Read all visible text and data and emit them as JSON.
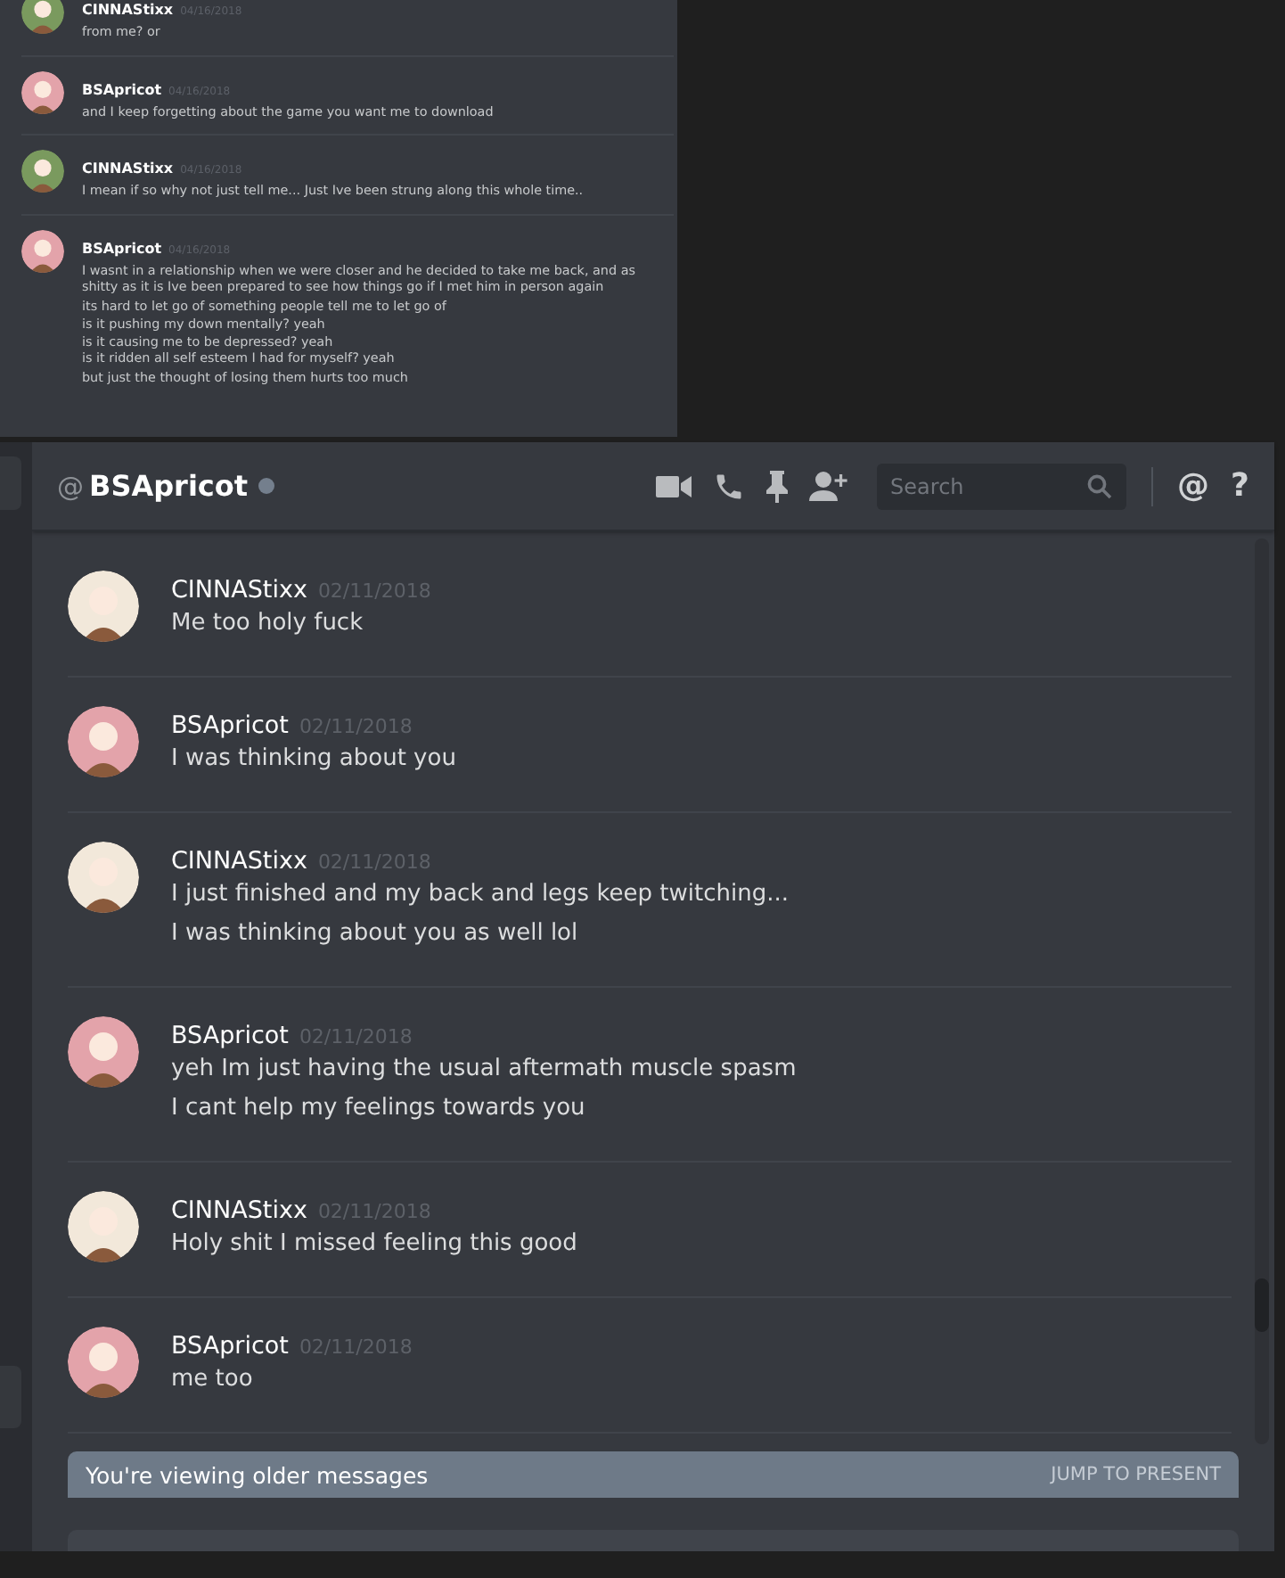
{
  "inset_chat": {
    "messages": [
      {
        "author": "CINNAStixx",
        "date": "04/16/2018",
        "color": "#7a9a5e",
        "lines": [
          "from me? or"
        ]
      },
      {
        "author": "BSApricot",
        "date": "04/16/2018",
        "color": "#e3a3aa",
        "lines": [
          "and I keep forgetting about the game you want me to download"
        ]
      },
      {
        "author": "CINNAStixx",
        "date": "04/16/2018",
        "color": "#7a9a5e",
        "lines": [
          "I mean if so why not just tell me... Just Ive been strung along this whole time.."
        ]
      },
      {
        "author": "BSApricot",
        "date": "04/16/2018",
        "color": "#e3a3aa",
        "lines": [
          "I wasnt in a relationship when we were closer and he decided to take me back, and as shitty as it is Ive been prepared to see how things go if I met him in person again",
          "its hard to let go of something people tell me to let go of",
          "is it pushing my down mentally? yeah\nis it causing me to be depressed? yeah\nis it ridden all self esteem I had for myself? yeah",
          "but just the thought of losing them hurts too much"
        ]
      }
    ]
  },
  "header": {
    "at_sign": "@",
    "name": "BSApricot",
    "search": {
      "placeholder": "Search"
    },
    "mention_button": "@",
    "help_button": "?"
  },
  "messages": [
    {
      "author": "CINNAStixx",
      "date": "02/11/2018",
      "color": "#f2e8da",
      "lines": [
        "Me too holy fuck"
      ]
    },
    {
      "author": "BSApricot",
      "date": "02/11/2018",
      "color": "#e3a3aa",
      "lines": [
        "I was thinking about you"
      ]
    },
    {
      "author": "CINNAStixx",
      "date": "02/11/2018",
      "color": "#f2e8da",
      "lines": [
        "I just finished and my back and legs keep twitching...",
        "I was thinking about you as well lol"
      ]
    },
    {
      "author": "BSApricot",
      "date": "02/11/2018",
      "color": "#e3a3aa",
      "lines": [
        "yeh Im just having the usual aftermath muscle spasm",
        "I cant help my feelings towards you"
      ]
    },
    {
      "author": "CINNAStixx",
      "date": "02/11/2018",
      "color": "#f2e8da",
      "lines": [
        "Holy shit I missed feeling this good"
      ]
    },
    {
      "author": "BSApricot",
      "date": "02/11/2018",
      "color": "#e3a3aa",
      "lines": [
        "me too"
      ]
    }
  ],
  "older_banner": {
    "text": "You're viewing older messages",
    "action": "JUMP TO PRESENT"
  }
}
